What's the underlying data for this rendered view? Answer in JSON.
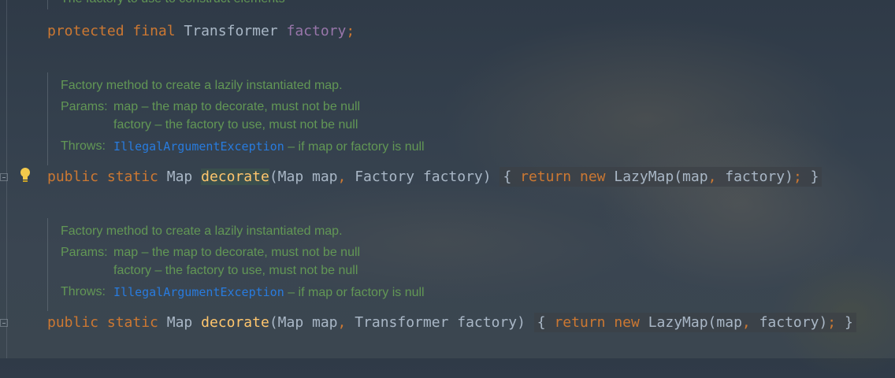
{
  "doc_top": {
    "text": "The factory to use to construct elements"
  },
  "field_line": {
    "k1": "protected",
    "k2": "final",
    "type": "Transformer",
    "name": "factory",
    "semi": ";"
  },
  "doc_blocks": [
    {
      "description": "Factory method to create a lazily instantiated map.",
      "params_label": "Params:",
      "param1": "map – the map to decorate, must not be null",
      "param2": "factory – the factory to use, must not be null",
      "throws_label": "Throws:",
      "exception": "IllegalArgumentException",
      "throws_text": " – if map or factory is null"
    },
    {
      "description": "Factory method to create a lazily instantiated map.",
      "params_label": "Params:",
      "param1": "map – the map to decorate, must not be null",
      "param2": "factory – the factory to use, must not be null",
      "throws_label": "Throws:",
      "exception": "IllegalArgumentException",
      "throws_text": " – if map or factory is null"
    }
  ],
  "methods": [
    {
      "k1": "public",
      "k2": "static",
      "ret": "Map",
      "name": "decorate",
      "params_a": "(Map map",
      "comma1": ",",
      "params_b": " Factory factory) ",
      "open": "{ ",
      "k3": "return",
      "k4": "new",
      "call_a": " LazyMap(map",
      "comma2": ",",
      "call_b": " factory)",
      "semi": ";",
      "close": " }"
    },
    {
      "k1": "public",
      "k2": "static",
      "ret": "Map",
      "name": "decorate",
      "params_a": "(Map map",
      "comma1": ",",
      "params_b": " Transformer factory) ",
      "open": "{ ",
      "k3": "return",
      "k4": "new",
      "call_a": " LazyMap(map",
      "comma2": ",",
      "call_b": " factory)",
      "semi": ";",
      "close": " }"
    }
  ],
  "colors": {
    "keyword": "#cc7832",
    "field": "#9876aa",
    "method": "#ffc66d",
    "text": "#a9b7c6",
    "doc": "#629755",
    "doc_link": "#287bde"
  },
  "icons": {
    "intention": "lightbulb-icon",
    "fold": "fold-marker-icon"
  }
}
